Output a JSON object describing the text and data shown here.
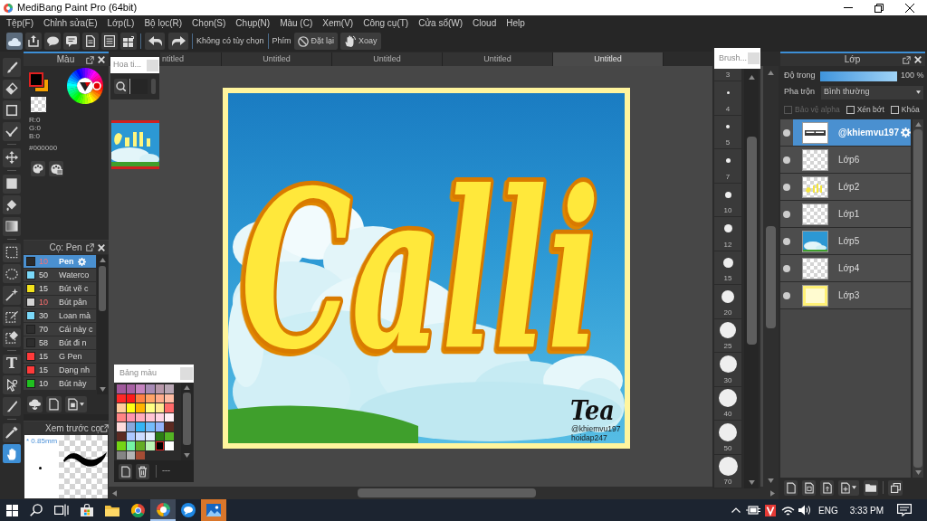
{
  "window": {
    "title": "MediBang Paint Pro (64bit)"
  },
  "menu": [
    "Tệp(F)",
    "Chỉnh sửa(E)",
    "Lớp(L)",
    "Bộ lọc(R)",
    "Chọn(S)",
    "Chụp(N)",
    "Màu (C)",
    "Xem(V)",
    "Công cụ(T)",
    "Cửa sổ(W)",
    "Cloud",
    "Help"
  ],
  "toolbar": {
    "buttons": [
      {
        "selected": true
      },
      {
        "selected": false
      },
      {
        "selected": false
      },
      {
        "selected": false
      },
      {
        "selected": false
      },
      {
        "selected": false
      },
      {
        "selected": false
      }
    ],
    "option_text": "Không có tùy chọn",
    "keys_label": "Phím",
    "actions": [
      "Đặt lại",
      "Xoay"
    ]
  },
  "tools": [
    {
      "selected": false
    },
    {
      "selected": false
    },
    {
      "selected": false
    },
    {
      "selected": false
    },
    {
      "selected": false
    },
    {
      "selected": false
    },
    {
      "selected": false
    },
    {
      "selected": false
    },
    {
      "selected": false
    },
    {
      "selected": false
    },
    {
      "selected": false
    },
    {
      "selected": false
    },
    {
      "selected": false
    },
    {
      "selected": false,
      "glyph": "T"
    },
    {
      "selected": false
    },
    {
      "selected": false
    },
    {
      "selected": false
    },
    {
      "selected": true
    }
  ],
  "color_panel": {
    "title": "Màu",
    "swatches": [
      {
        "color": "#000000",
        "selected": true
      },
      {
        "color": "#f5a000",
        "selected": false
      }
    ],
    "rgb": [
      "R:0",
      "G:0",
      "B:0"
    ],
    "hex": "#000000"
  },
  "brush_panel": {
    "title": "Cọ: Pen",
    "brushes": [
      {
        "color": "#2a2a2a",
        "size": "10",
        "size_highlighted": true,
        "name": "Pen",
        "selected": true
      },
      {
        "color": "#7ad8f8",
        "size": "50",
        "size_highlighted": false,
        "name": "Waterco",
        "selected": false
      },
      {
        "color": "#f2e21c",
        "size": "15",
        "size_highlighted": false,
        "name": "Bút vẽ c",
        "selected": false
      },
      {
        "color": "#d4d4d4",
        "size": "10",
        "size_highlighted": true,
        "name": "Bút pân",
        "selected": false
      },
      {
        "color": "#7ad8f8",
        "size": "30",
        "size_highlighted": false,
        "name": "Loan mà",
        "selected": false
      },
      {
        "color": "#2e2e2e",
        "size": "70",
        "size_highlighted": false,
        "name": "Cái này c",
        "selected": false
      },
      {
        "color": "#2e2e2e",
        "size": "58",
        "size_highlighted": false,
        "name": "Bút đi n",
        "selected": false
      },
      {
        "color": "#ff3a3a",
        "size": "15",
        "size_highlighted": false,
        "name": "G Pen",
        "selected": false
      },
      {
        "color": "#ff3a3a",
        "size": "15",
        "size_highlighted": false,
        "name": "Dạng nh",
        "selected": false
      },
      {
        "color": "#20c020",
        "size": "10",
        "size_highlighted": false,
        "name": "Bút này",
        "selected": false
      }
    ]
  },
  "brush_preview": {
    "title": "Xem trước cọ",
    "size": "* 0.85mm"
  },
  "pattern_panel": {
    "title": "Hoa ti...",
    "thumbnail_selected": true
  },
  "tabs": [
    {
      "label": "ntitled",
      "selected": false
    },
    {
      "label": "Untitled",
      "selected": false
    },
    {
      "label": "Untitled",
      "selected": false
    },
    {
      "label": "Untitled",
      "selected": false
    },
    {
      "label": "Untitled",
      "selected": true
    }
  ],
  "canvas": {
    "lettering": "Calli",
    "signature": "Tea",
    "credits": [
      "@khiemvu197",
      "hoidap247"
    ]
  },
  "palette": {
    "title": "Bảng màu",
    "colors": [
      {
        "color": "#a05a9c",
        "selected": false
      },
      {
        "color": "#a861a4",
        "selected": false
      },
      {
        "color": "#c584c0",
        "selected": false
      },
      {
        "color": "#a88cb6",
        "selected": false
      },
      {
        "color": "#b898aa",
        "selected": false
      },
      {
        "color": "#b8a6b4",
        "selected": false
      },
      {
        "color": "#ff2828",
        "selected": false
      },
      {
        "color": "#ff1a1a",
        "selected": false
      },
      {
        "color": "#ff8044",
        "selected": false
      },
      {
        "color": "#ffa468",
        "selected": false
      },
      {
        "color": "#ffac8c",
        "selected": false
      },
      {
        "color": "#ffbca4",
        "selected": false
      },
      {
        "color": "#ffcc9c",
        "selected": false
      },
      {
        "color": "#ffff14",
        "selected": false
      },
      {
        "color": "#ffb400",
        "selected": false
      },
      {
        "color": "#ffff84",
        "selected": false
      },
      {
        "color": "#ffea94",
        "selected": false
      },
      {
        "color": "#ff6a6a",
        "selected": false
      },
      {
        "color": "#ff8484",
        "selected": false
      },
      {
        "color": "#ff94ac",
        "selected": false
      },
      {
        "color": "#ffacbc",
        "selected": false
      },
      {
        "color": "#ffc4d4",
        "selected": false
      },
      {
        "color": "#ffd4e4",
        "selected": false
      },
      {
        "color": "#fff0f6",
        "selected": false
      },
      {
        "color": "#ffdcdc",
        "selected": false
      },
      {
        "color": "#88a8dc",
        "selected": false
      },
      {
        "color": "#34b4f4",
        "selected": false
      },
      {
        "color": "#74bcfc",
        "selected": false
      },
      {
        "color": "#94b4fc",
        "selected": false
      },
      {
        "color": "#5c2a22",
        "selected": false
      },
      {
        "color": "#5c2a22",
        "selected": false
      },
      {
        "color": "#acc8ff",
        "selected": false
      },
      {
        "color": "#ccdcff",
        "selected": false
      },
      {
        "color": "#e4eeff",
        "selected": false
      },
      {
        "color": "#2c7c14",
        "selected": false
      },
      {
        "color": "#54b424",
        "selected": false
      },
      {
        "color": "#74d414",
        "selected": false
      },
      {
        "color": "#74f4a4",
        "selected": false
      },
      {
        "color": "#64ac24",
        "selected": false
      },
      {
        "color": "#bcf4b4",
        "selected": false
      },
      {
        "color": "#000000",
        "selected": true
      },
      {
        "color": "#ffffff",
        "selected": false
      },
      {
        "color": "#848484",
        "selected": false
      },
      {
        "color": "#b4b4b4",
        "selected": false
      },
      {
        "color": "#a44c34",
        "selected": false
      }
    ],
    "footer": "---"
  },
  "brush_sizes": {
    "title": "Brush...",
    "sizes": [
      "3",
      "4",
      "5",
      "7",
      "10",
      "12",
      "15",
      "20",
      "25",
      "30",
      "40",
      "50",
      "70"
    ]
  },
  "layer_panel": {
    "title": "Lớp",
    "opacity_label": "Độ trong",
    "opacity": {
      "level": 1
    },
    "opacity_text": "100 %",
    "blend_label": "Pha trộn",
    "blend_value": "Bình thường",
    "options": [
      {
        "label": "Bảo vệ alpha",
        "checked": false,
        "disabled": true
      },
      {
        "label": "Xén bớt",
        "checked": false,
        "disabled": false
      },
      {
        "label": "Khóa",
        "checked": false,
        "disabled": false
      }
    ],
    "layers": [
      {
        "name": "@khiemvu197",
        "kind": "text",
        "visible": true,
        "selected": true
      },
      {
        "name": "Lớp6",
        "kind": "blank",
        "visible": true,
        "selected": false
      },
      {
        "name": "Lớp2",
        "kind": "lettering",
        "visible": true,
        "selected": false
      },
      {
        "name": "Lớp1",
        "kind": "blank",
        "visible": true,
        "selected": false
      },
      {
        "name": "Lớp5",
        "kind": "sky",
        "visible": true,
        "selected": false
      },
      {
        "name": "Lớp4",
        "kind": "blank",
        "visible": true,
        "selected": false
      },
      {
        "name": "Lớp3",
        "kind": "fill",
        "visible": true,
        "selected": false
      }
    ]
  },
  "taskbar": {
    "apps": [
      {
        "selected": false,
        "attention": false
      },
      {
        "selected": false,
        "attention": false
      },
      {
        "selected": false,
        "attention": false
      },
      {
        "selected": true,
        "attention": false
      },
      {
        "selected": false,
        "attention": false
      },
      {
        "selected": false,
        "attention": true
      }
    ],
    "language": "ENG",
    "time": "3:33 PM"
  }
}
